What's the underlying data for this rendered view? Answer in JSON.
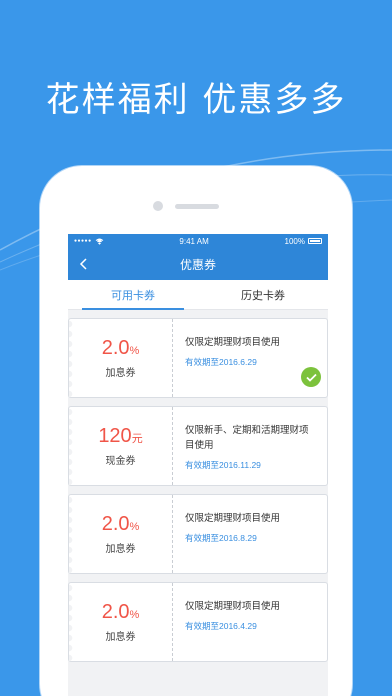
{
  "headline": "花样福利 优惠多多",
  "status_bar": {
    "signal": "●●●●●",
    "time": "9:41 AM",
    "battery": "100%"
  },
  "navbar": {
    "back_icon": "chevron-left-icon",
    "title": "优惠券"
  },
  "tabs": [
    {
      "label": "可用卡券",
      "active": true
    },
    {
      "label": "历史卡券",
      "active": false
    }
  ],
  "coupons": [
    {
      "amount": "2.0",
      "unit": "%",
      "type": "加息券",
      "desc": "仅限定期理财项目使用",
      "validity": "有效期至2016.6.29",
      "selected": true
    },
    {
      "amount": "120",
      "unit": "元",
      "type": "现金券",
      "desc": "仅限新手、定期和活期理财项目使用",
      "validity": "有效期至2016.11.29",
      "selected": false
    },
    {
      "amount": "2.0",
      "unit": "%",
      "type": "加息券",
      "desc": "仅限定期理财项目使用",
      "validity": "有效期至2016.8.29",
      "selected": false
    },
    {
      "amount": "2.0",
      "unit": "%",
      "type": "加息券",
      "desc": "仅限定期理财项目使用",
      "validity": "有效期至2016.4.29",
      "selected": false
    }
  ],
  "colors": {
    "background": "#3a97ea",
    "accent": "#2e86d8",
    "amount": "#f05548",
    "check": "#7cc23c"
  }
}
